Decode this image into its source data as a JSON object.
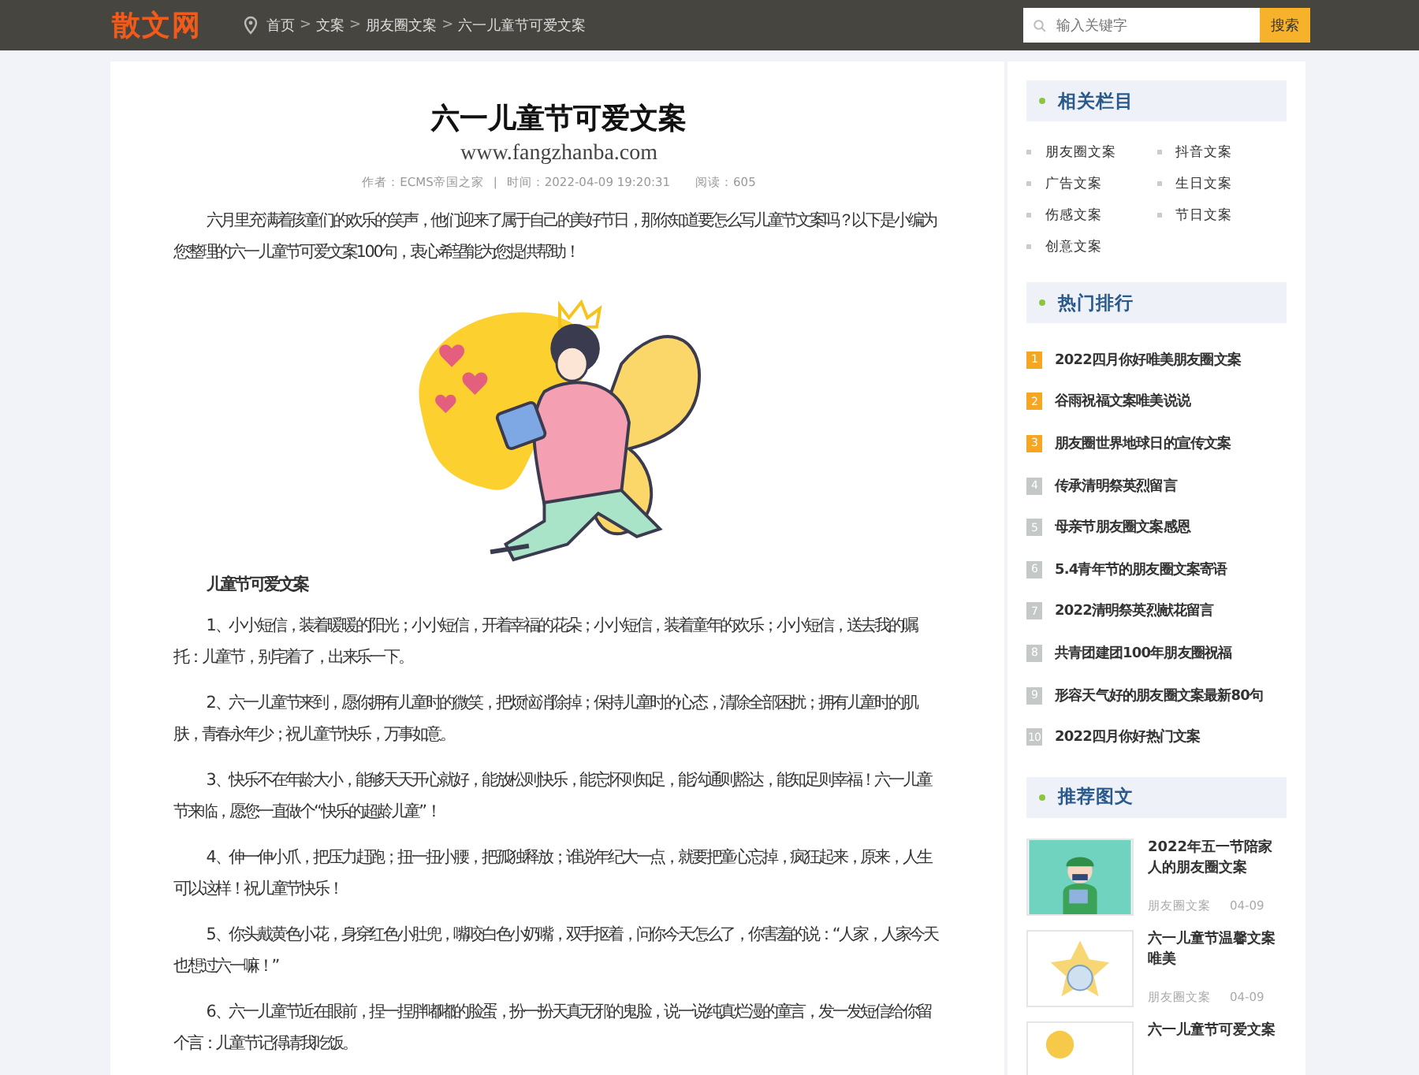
{
  "header": {
    "logo": "散文网",
    "breadcrumb": [
      "首页",
      "文案",
      "朋友圈文案",
      "六一儿童节可爱文案"
    ],
    "breadcrumb_separator": ">",
    "search": {
      "placeholder": "输入关键字",
      "button": "搜索"
    }
  },
  "article": {
    "title": "六一儿童节可爱文案",
    "site": "www.fangzhanba.com",
    "meta": {
      "author": "作者：ECMS帝国之家",
      "divider": "|",
      "time": "时间：2022-04-09 19:20:31",
      "views": "阅读：605"
    },
    "intro": "六月里充满着孩童们的欢乐的笑声，他们迎来了属于自己的美好节日，那你知道要怎么写儿童节文案吗？以下是小编为您整理的六一儿童节可爱文案100句，衷心希望能为您提供帮助！",
    "subheading": "儿童节可爱文案",
    "paragraphs": [
      "1、小小短信，装着暖暖的阳光；小小短信，开着幸福的花朵；小小短信，装着童年的欢乐；小小短信，送去我的嘱托：儿童节，别宅着了，出来乐一下。",
      "2、六一儿童节来到，愿你拥有儿童时的微笑，把烦恼消除掉；保持儿童时的心态，清除全部困扰；拥有儿童时的肌肤，青春永年少；祝儿童节快乐，万事如意。",
      "3、快乐不在年龄大小，能够天天开心就好，能放松则快乐，能忘怀则知足，能沟通则豁达，能知足则幸福！六一儿童节来临，愿您一直做个“快乐的超龄儿童”！",
      "4、伸一伸小爪，把压力赶跑；扭一扭小腰，把孤独释放；谁说年纪大一点，就要把童心忘掉，疯狂起来，原来，人生可以这样！祝儿童节快乐！",
      "5、你头戴黄色小花，身穿红色小肚兜，嘴咬白色小奶嘴，双手抠着，问你今天怎么了，你害羞的说：“人家，人家今天也想过六一嘛！”",
      "6、六一儿童节近在眼前，捏一捏胖嘟嘟的脸蛋，扮一扮天真无邪的鬼脸，说一说纯真烂漫的童言，发一发短信给你留个言：儿童节记得请我吃饭。"
    ]
  },
  "sidebar": {
    "related": {
      "title": "相关栏目",
      "items": [
        "朋友圈文案",
        "抖音文案",
        "广告文案",
        "生日文案",
        "伤感文案",
        "节日文案",
        "创意文案"
      ]
    },
    "hot": {
      "title": "热门排行",
      "items": [
        {
          "rank": "1",
          "title": "2022四月你好唯美朋友圈文案",
          "color": "#f5a623"
        },
        {
          "rank": "2",
          "title": "谷雨祝福文案唯美说说",
          "color": "#f5a623"
        },
        {
          "rank": "3",
          "title": "朋友圈世界地球日的宣传文案",
          "color": "#f5a623"
        },
        {
          "rank": "4",
          "title": "传承清明祭英烈留言",
          "color": "#c4c8c6"
        },
        {
          "rank": "5",
          "title": "母亲节朋友圈文案感恩",
          "color": "#c4c8c6"
        },
        {
          "rank": "6",
          "title": "5.4青年节的朋友圈文案寄语",
          "color": "#c4c8c6"
        },
        {
          "rank": "7",
          "title": "2022清明祭英烈献花留言",
          "color": "#c4c8c6"
        },
        {
          "rank": "8",
          "title": "共青团建团100年朋友圈祝福",
          "color": "#c4c8c6"
        },
        {
          "rank": "9",
          "title": "形容天气好的朋友圈文案最新80句",
          "color": "#c4c8c6"
        },
        {
          "rank": "10",
          "title": "2022四月你好热门文案",
          "color": "#c4c8c6"
        }
      ]
    },
    "recommended": {
      "title": "推荐图文",
      "items": [
        {
          "kind": "soldier",
          "title": "2022年五一节陪家人的朋友圈文案",
          "category": "朋友圈文案",
          "date": "04-09"
        },
        {
          "kind": "star",
          "title": "六一儿童节温馨文案唯美",
          "category": "朋友圈文案",
          "date": "04-09"
        },
        {
          "kind": "sun",
          "title": "六一儿童节可爱文案"
        }
      ]
    }
  }
}
